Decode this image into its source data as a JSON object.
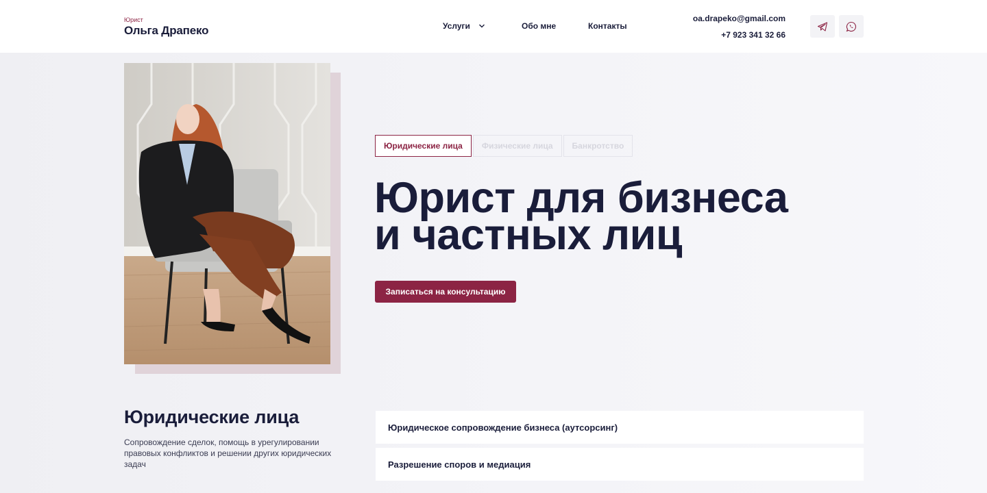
{
  "header": {
    "logo_small": "Юрист",
    "logo_name": "Ольга Драпеко",
    "nav": [
      {
        "label": "Услуги"
      },
      {
        "label": "Обо мне"
      },
      {
        "label": "Контакты"
      }
    ],
    "email": "oa.drapeko@gmail.com",
    "phone": "+7 923 341 32 66",
    "social_icons": [
      "telegram-icon",
      "whatsapp-icon"
    ]
  },
  "hero": {
    "tabs": [
      {
        "label": "Юридические лица",
        "active": true
      },
      {
        "label": "Физические лица",
        "active": false
      },
      {
        "label": "Банкротство",
        "active": false
      }
    ],
    "title_line1": "Юрист для бизнеса",
    "title_line2": "и частных лиц",
    "cta_label": "Записаться на консультацию"
  },
  "section": {
    "title": "Юридические лица",
    "description": "Сопровождение сделок, помощь в урегулировании правовых конфликтов и решении других юридических задач",
    "services": [
      "Юридическое сопровождение бизнеса (аутсорсинг)",
      "Разрешение споров и медиация"
    ]
  },
  "colors": {
    "accent": "#8c2444",
    "text": "#1a1d3a",
    "photo_shadow": "#e0d3d9"
  }
}
